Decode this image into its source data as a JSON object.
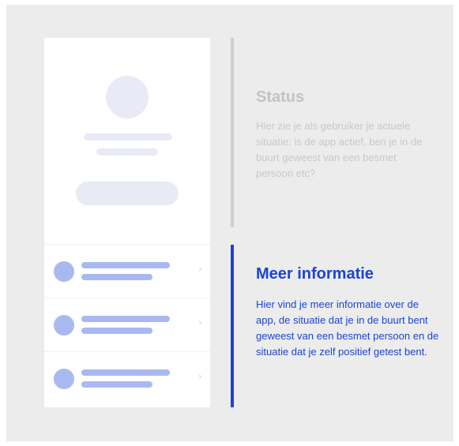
{
  "status": {
    "title": "Status",
    "body": "Hier zie je als gebruiker je actuele situatie: is de app actief, ben je in de buurt geweest van een besmet persoon etc?"
  },
  "more_info": {
    "title": "Meer informatie",
    "body": "Hier vind je meer informatie over de app, de situatie dat je in de buurt bent geweest van een besmet persoon en de situatie dat je zelf positief getest bent."
  },
  "phone": {
    "rows": [
      {
        "chevron": "›",
        "icon": "chevron-right-icon"
      },
      {
        "chevron": "›",
        "icon": "chevron-right-icon"
      },
      {
        "chevron": "›",
        "icon": "chevron-right-icon"
      }
    ]
  },
  "colors": {
    "accent": "#1c43d6",
    "muted_text": "#c3c3c3",
    "placeholder_light": "#e8ebf5",
    "placeholder_blue": "#a9b9f0",
    "background": "#ececec"
  }
}
